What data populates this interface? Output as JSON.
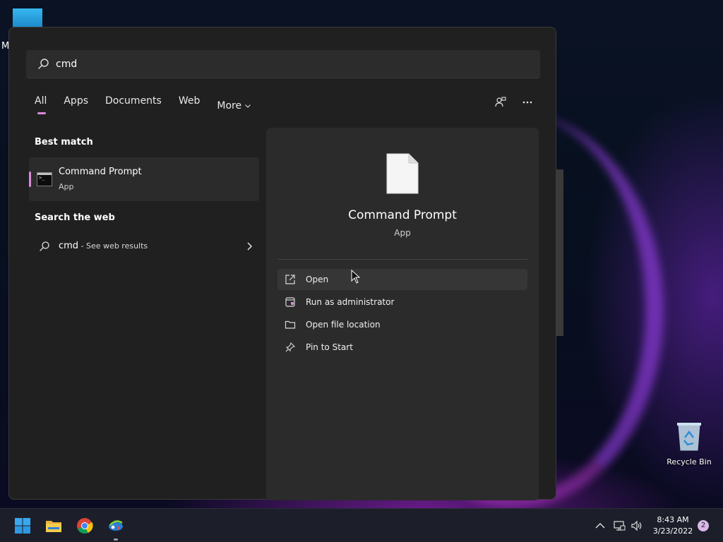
{
  "desktop": {
    "partial_label": "M",
    "recycle_bin_label": "Recycle Bin"
  },
  "search": {
    "query": "cmd"
  },
  "tabs": [
    {
      "label": "All",
      "active": true
    },
    {
      "label": "Apps"
    },
    {
      "label": "Documents"
    },
    {
      "label": "Web"
    },
    {
      "label": "More"
    }
  ],
  "results": {
    "best_match_title": "Best match",
    "best_match": {
      "name": "Command Prompt",
      "type": "App"
    },
    "web_title": "Search the web",
    "web_item": {
      "query": "cmd",
      "suffix": " - See web results"
    }
  },
  "detail": {
    "name": "Command Prompt",
    "type": "App",
    "actions": [
      {
        "label": "Open",
        "icon": "open-external-icon"
      },
      {
        "label": "Run as administrator",
        "icon": "shield-window-icon"
      },
      {
        "label": "Open file location",
        "icon": "folder-icon"
      },
      {
        "label": "Pin to Start",
        "icon": "pin-icon"
      }
    ]
  },
  "taskbar": {
    "time": "8:43 AM",
    "date": "3/23/2022",
    "notifications": "2"
  },
  "colors": {
    "accent": "#d88ad8",
    "panel_bg": "#202020",
    "pane_bg": "#2b2b2b"
  }
}
